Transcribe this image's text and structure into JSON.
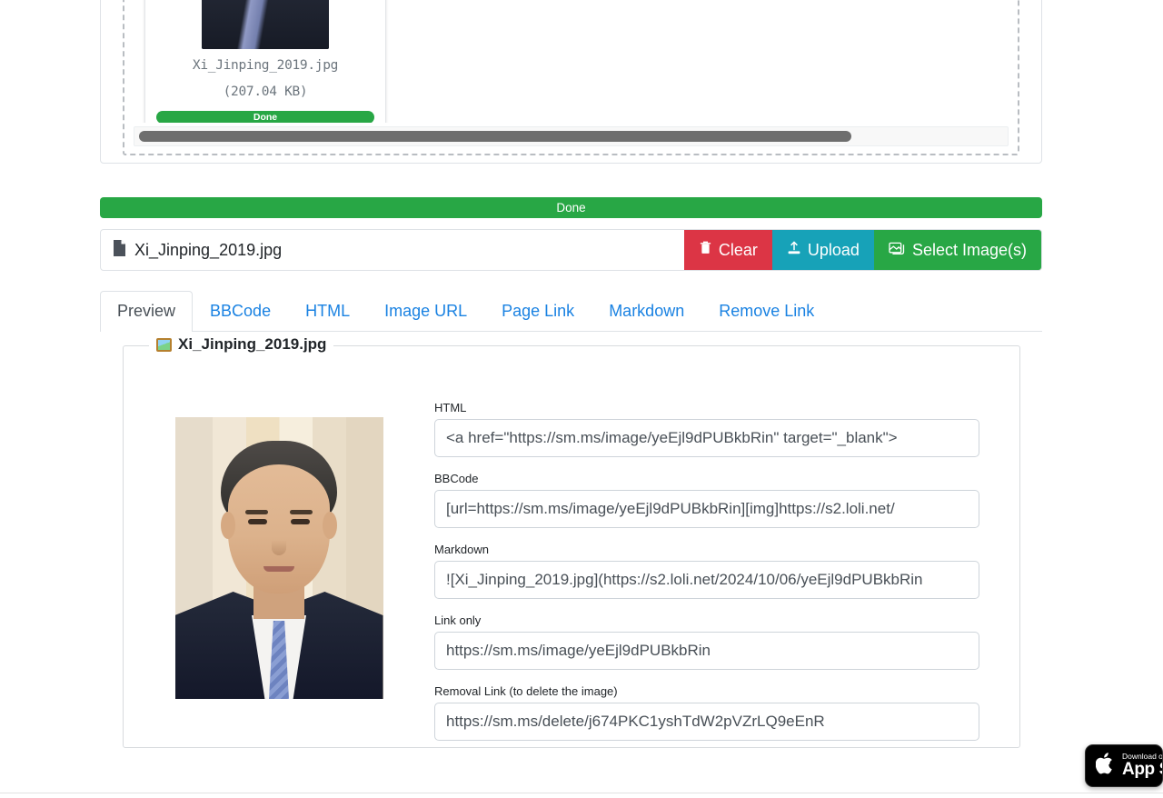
{
  "dropzone": {
    "thumbnail": {
      "file_name": "Xi_Jinping_2019.jpg",
      "file_size": "(207.04 KB)",
      "progress_label": "Done",
      "status_icon": "check-circle-icon",
      "delete_icon": "trash-icon",
      "zoom_icon": "magnifier-plus-icon"
    }
  },
  "global_progress": {
    "label": "Done",
    "color": "#28a745"
  },
  "file_row": {
    "file_icon": "document-icon",
    "file_name": "Xi_Jinping_2019.jpg",
    "buttons": [
      {
        "label": "Clear",
        "icon": "trash-icon",
        "color": "#dc3545"
      },
      {
        "label": "Upload",
        "icon": "upload-icon",
        "color": "#17a2b8"
      },
      {
        "label": "Select Image(s)",
        "icon": "images-icon",
        "color": "#28a745"
      }
    ]
  },
  "tabs": [
    {
      "label": "Preview",
      "active": true
    },
    {
      "label": "BBCode",
      "active": false
    },
    {
      "label": "HTML",
      "active": false
    },
    {
      "label": "Image URL",
      "active": false
    },
    {
      "label": "Page Link",
      "active": false
    },
    {
      "label": "Markdown",
      "active": false
    },
    {
      "label": "Remove Link",
      "active": false
    }
  ],
  "result": {
    "legend": "Xi_Jinping_2019.jpg",
    "legend_icon": "picture-icon",
    "preview_alt": "Xi_Jinping_2019.jpg",
    "fields": [
      {
        "label": "HTML",
        "value": "<a href=\"https://sm.ms/image/yeEjl9dPUBkbRin\" target=\"_blank\">"
      },
      {
        "label": "BBCode",
        "value": "[url=https://sm.ms/image/yeEjl9dPUBkbRin][img]https://s2.loli.net/"
      },
      {
        "label": "Markdown",
        "value": "![Xi_Jinping_2019.jpg](https://s2.loli.net/2024/10/06/yeEjl9dPUBkbRin"
      },
      {
        "label": "Link only",
        "value": "https://sm.ms/image/yeEjl9dPUBkbRin"
      },
      {
        "label": "Removal Link (to delete the image)",
        "value": "https://sm.ms/delete/j674PKC1yshTdW2pVZrLQ9eEnR"
      }
    ]
  },
  "appstore_badge": {
    "small_text": "Download on the",
    "big_text": "App Store",
    "icon": "apple-logo-icon"
  }
}
